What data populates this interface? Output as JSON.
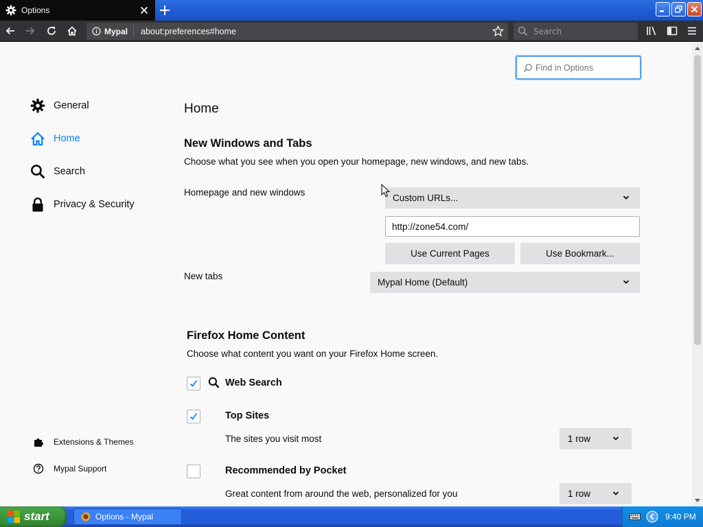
{
  "browser": {
    "tab_title": "Options",
    "identity_label": "Mypal",
    "url": "about:preferences#home",
    "search_placeholder": "Search"
  },
  "prefs": {
    "find_placeholder": "Find in Options",
    "categories": [
      {
        "label": "General",
        "icon": "gear-icon",
        "selected": false
      },
      {
        "label": "Home",
        "icon": "home-icon",
        "selected": true
      },
      {
        "label": "Search",
        "icon": "search-icon",
        "selected": false
      },
      {
        "label": "Privacy & Security",
        "icon": "lock-icon",
        "selected": false
      }
    ],
    "footer_links": [
      {
        "label": "Extensions & Themes",
        "icon": "puzzle-icon"
      },
      {
        "label": "Mypal Support",
        "icon": "help-icon"
      }
    ],
    "page_title": "Home",
    "windows_tabs": {
      "heading": "New Windows and Tabs",
      "description": "Choose what you see when you open your homepage, new windows, and new tabs.",
      "homepage_label": "Homepage and new windows",
      "homepage_select": "Custom URLs...",
      "homepage_url": "http://zone54.com/",
      "use_current_label": "Use Current Pages",
      "use_bookmark_label": "Use Bookmark...",
      "newtabs_label": "New tabs",
      "newtabs_select": "Mypal Home (Default)"
    },
    "home_content": {
      "heading": "Firefox Home Content",
      "description": "Choose what content you want on your Firefox Home screen.",
      "web_search": {
        "label": "Web Search",
        "checked": true
      },
      "top_sites": {
        "label": "Top Sites",
        "checked": true,
        "description": "The sites you visit most",
        "rows": "1 row"
      },
      "pocket": {
        "label": "Recommended by Pocket",
        "checked": false,
        "description": "Great content from around the web, personalized for you",
        "rows": "1 row"
      }
    }
  },
  "taskbar": {
    "start_label": "start",
    "task_label": "Options - Mypal",
    "clock": "9:40 PM"
  },
  "colors": {
    "accent": "#0a84ff",
    "chrome_dark": "#323234",
    "xp_blue": "#245edb",
    "xp_green": "#3c973c"
  }
}
